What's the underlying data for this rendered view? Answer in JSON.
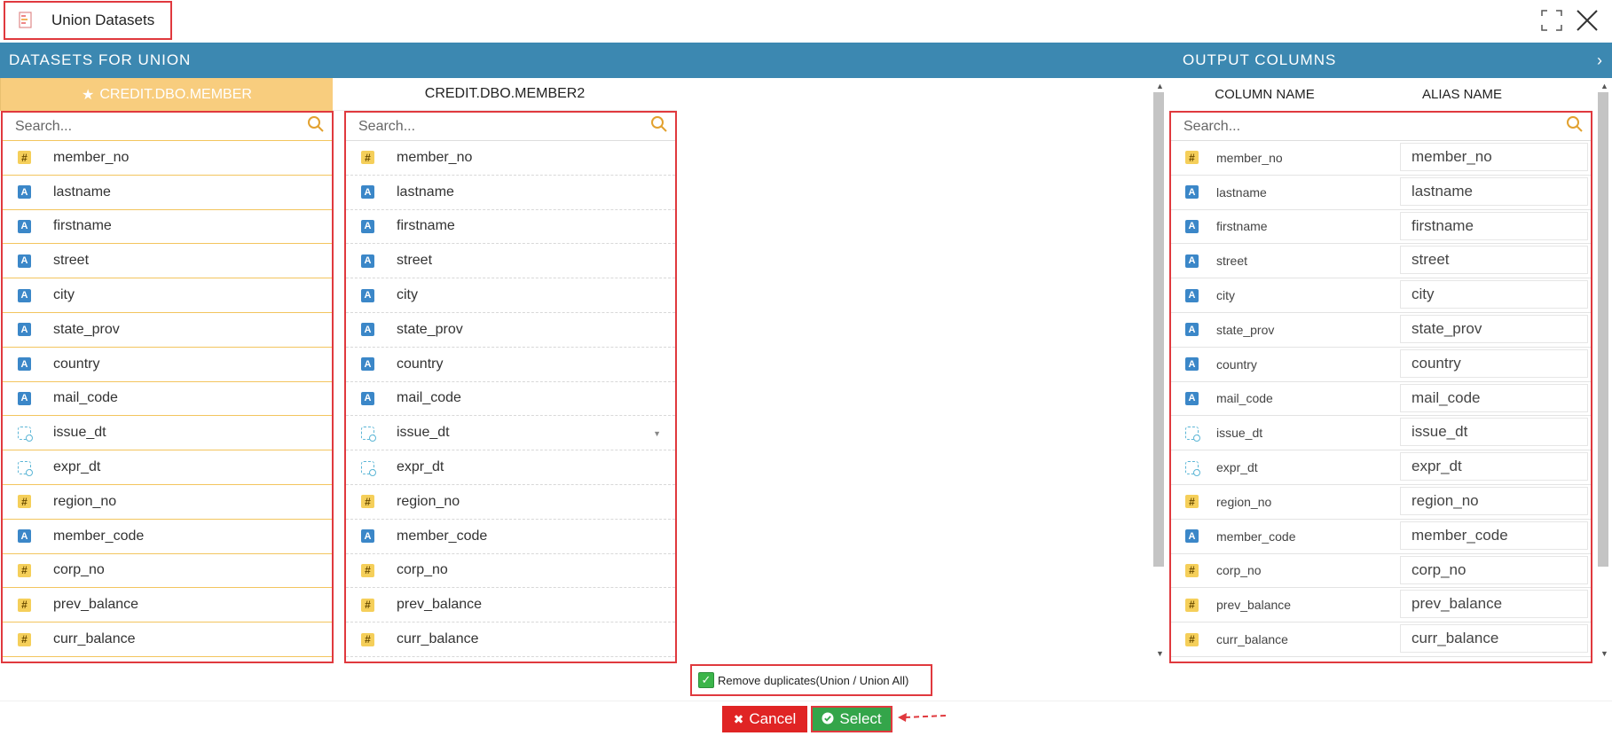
{
  "window": {
    "title": "Union Datasets"
  },
  "sections": {
    "left_title": "DATASETS FOR UNION",
    "right_title": "OUTPUT COLUMNS",
    "collapse_glyph": "›"
  },
  "datasets": [
    {
      "name": "CREDIT.DBO.MEMBER",
      "primary": true
    },
    {
      "name": "CREDIT.DBO.MEMBER2",
      "primary": false
    }
  ],
  "search_placeholder": "Search...",
  "output_headers": {
    "column_name": "COLUMN NAME",
    "alias_name": "ALIAS NAME"
  },
  "columns": [
    {
      "name": "member_no",
      "type": "number"
    },
    {
      "name": "lastname",
      "type": "text"
    },
    {
      "name": "firstname",
      "type": "text"
    },
    {
      "name": "street",
      "type": "text"
    },
    {
      "name": "city",
      "type": "text"
    },
    {
      "name": "state_prov",
      "type": "text"
    },
    {
      "name": "country",
      "type": "text"
    },
    {
      "name": "mail_code",
      "type": "text"
    },
    {
      "name": "issue_dt",
      "type": "date"
    },
    {
      "name": "expr_dt",
      "type": "date"
    },
    {
      "name": "region_no",
      "type": "number"
    },
    {
      "name": "member_code",
      "type": "text"
    },
    {
      "name": "corp_no",
      "type": "number"
    },
    {
      "name": "prev_balance",
      "type": "number"
    },
    {
      "name": "curr_balance",
      "type": "number"
    }
  ],
  "footer": {
    "remove_duplicates_label": "Remove duplicates(Union / Union All)",
    "remove_duplicates_checked": true,
    "cancel_label": "Cancel",
    "select_label": "Select"
  },
  "icons": {
    "number": "hash-icon",
    "text": "text-a-icon",
    "date": "calendar-icon"
  },
  "colors": {
    "header_band": "#3c88b1",
    "primary_dataset_tab": "#f8cd7e",
    "highlight_border": "#e0393e",
    "cancel": "#e02424",
    "select": "#34a54a"
  }
}
